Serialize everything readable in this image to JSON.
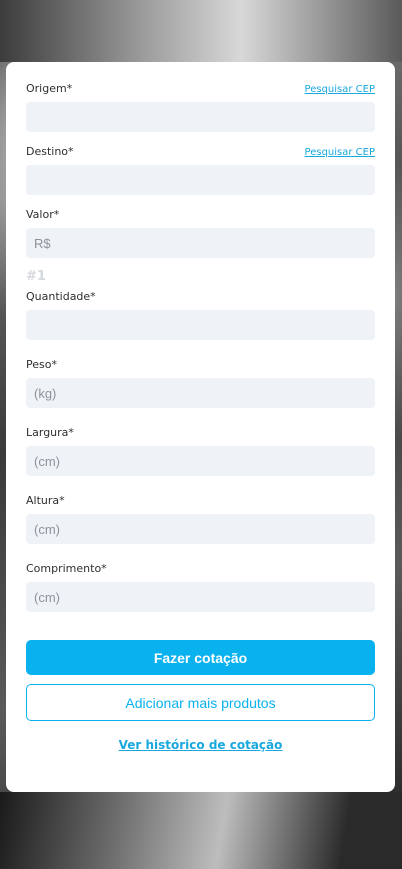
{
  "form": {
    "origem": {
      "label": "Origem*",
      "link": "Pesquisar CEP",
      "value": "",
      "placeholder": ""
    },
    "destino": {
      "label": "Destino*",
      "link": "Pesquisar CEP",
      "value": "",
      "placeholder": ""
    },
    "valor": {
      "label": "Valor*",
      "value": "",
      "placeholder": "R$"
    },
    "item_index": "#1",
    "quantidade": {
      "label": "Quantidade*",
      "value": "",
      "placeholder": ""
    },
    "peso": {
      "label": "Peso*",
      "value": "",
      "placeholder": "(kg)"
    },
    "largura": {
      "label": "Largura*",
      "value": "",
      "placeholder": "(cm)"
    },
    "altura": {
      "label": "Altura*",
      "value": "",
      "placeholder": "(cm)"
    },
    "comprimento": {
      "label": "Comprimento*",
      "value": "",
      "placeholder": "(cm)"
    }
  },
  "actions": {
    "submit_label": "Fazer cotação",
    "add_products_label": "Adicionar mais produtos",
    "history_link": "Ver histórico de cotação"
  },
  "colors": {
    "accent": "#09b1ee",
    "input_bg": "#eff2f6",
    "card_bg": "#ffffff"
  }
}
